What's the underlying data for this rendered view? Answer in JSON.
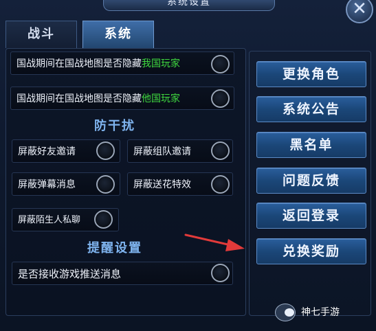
{
  "window": {
    "title": "系统设置",
    "close_icon": "close-icon"
  },
  "tabs": [
    {
      "label": "战斗",
      "active": false
    },
    {
      "label": "系统",
      "active": true
    }
  ],
  "options": {
    "hide_own_players": {
      "prefix": "国战期间在国战地图是否隐藏",
      "highlight": "我国玩家"
    },
    "hide_enemy_players": {
      "prefix": "国战期间在国战地图是否隐藏",
      "highlight": "他国玩家"
    }
  },
  "anti_disturb": {
    "title": "防干扰",
    "items": [
      {
        "label": "屏蔽好友邀请"
      },
      {
        "label": "屏蔽组队邀请"
      },
      {
        "label": "屏蔽弹幕消息"
      },
      {
        "label": "屏蔽送花特效"
      },
      {
        "label": "屏蔽陌生人私聊"
      }
    ]
  },
  "reminder": {
    "title": "提醒设置",
    "items": [
      {
        "label": "是否接收游戏推送消息"
      }
    ]
  },
  "side_buttons": [
    {
      "label": "更换角色"
    },
    {
      "label": "系统公告"
    },
    {
      "label": "黑名单"
    },
    {
      "label": "问题反馈"
    },
    {
      "label": "返回登录"
    },
    {
      "label": "兑换奖励"
    }
  ],
  "colors": {
    "highlight_green": "#3fd83f",
    "section_blue": "#7fb4ef",
    "button_blue": "#1b4779",
    "arrow_red": "#e23a3a"
  },
  "watermark": {
    "text": "神七手游"
  }
}
